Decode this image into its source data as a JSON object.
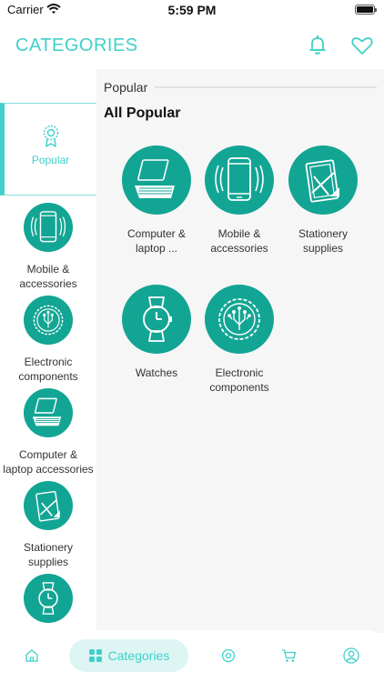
{
  "status_bar": {
    "carrier": "Carrier",
    "time": "5:59 PM"
  },
  "header": {
    "title": "CATEGORIES",
    "icons": [
      "bell-icon",
      "heart-icon"
    ]
  },
  "sidebar": {
    "popular_label": "Popular",
    "items": [
      {
        "label": "Mobile &\naccessories",
        "icon": "mobile-icon"
      },
      {
        "label": "Electronic\ncomponents",
        "icon": "circuit-icon"
      },
      {
        "label": "Computer &\nlaptop accessories",
        "icon": "laptop-icon"
      },
      {
        "label": "Stationery\nsupplies",
        "icon": "stationery-icon"
      },
      {
        "label": "",
        "icon": "watch-icon"
      }
    ]
  },
  "main": {
    "section_label": "Popular",
    "section_title": "All Popular",
    "grid": [
      {
        "label": "Computer &\nlaptop ...",
        "icon": "laptop-icon"
      },
      {
        "label": "Mobile &\naccessories",
        "icon": "mobile-icon"
      },
      {
        "label": "Stationery\nsupplies",
        "icon": "stationery-icon"
      },
      {
        "label": "Watches",
        "icon": "watch-icon"
      },
      {
        "label": "Electronic\ncomponents",
        "icon": "circuit-icon"
      }
    ]
  },
  "bottom_nav": {
    "active_label": "Categories",
    "items": [
      "home-icon",
      "categories-icon",
      "center-icon",
      "cart-icon",
      "profile-icon"
    ]
  },
  "colors": {
    "accent": "#3fd1c9",
    "circle": "#12a594",
    "main_bg": "#f6f6f6",
    "active_pill": "#ddf6f4"
  }
}
